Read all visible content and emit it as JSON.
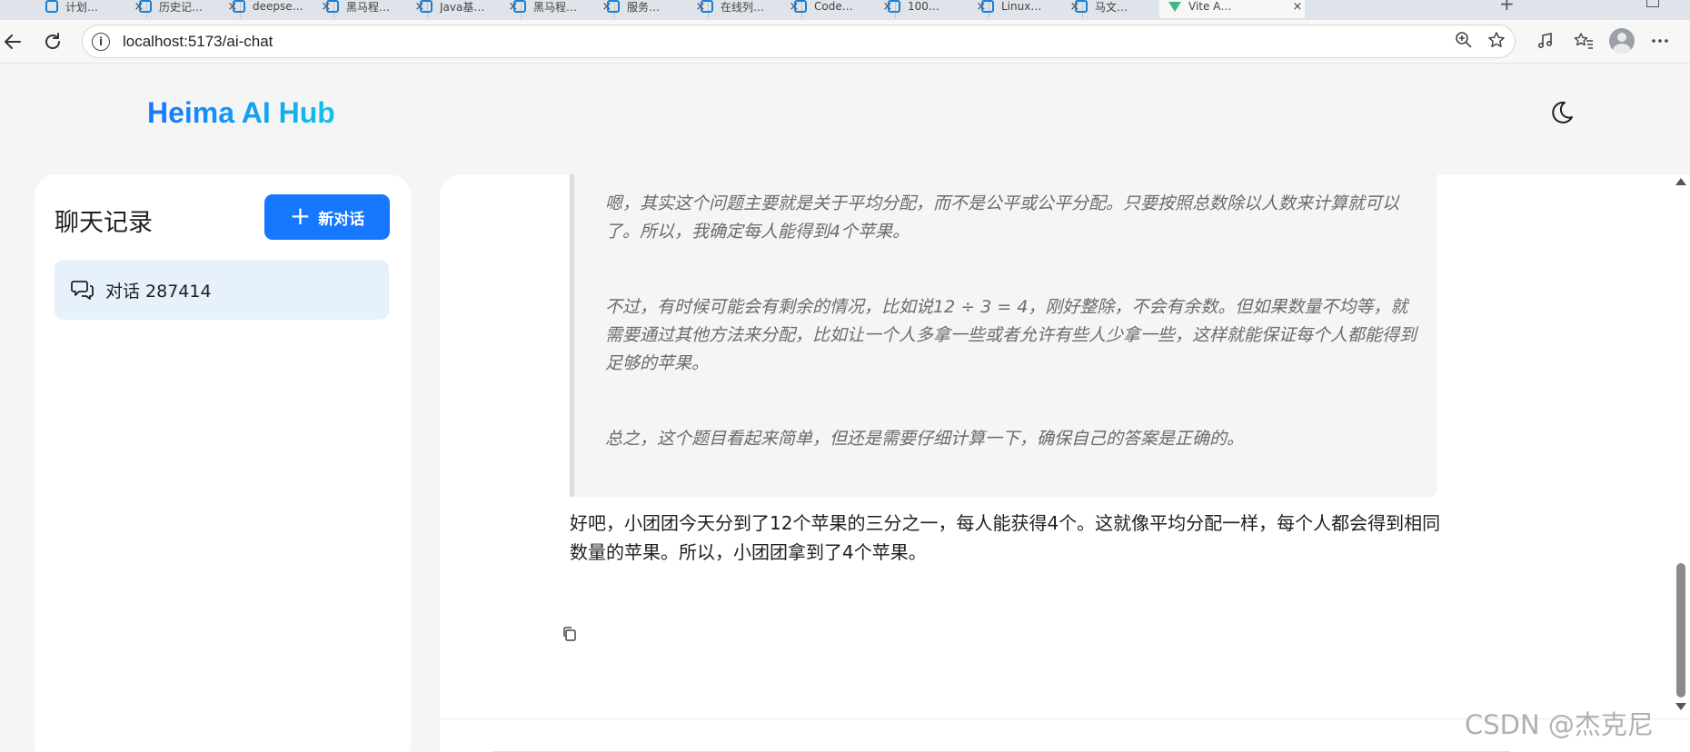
{
  "browser": {
    "tabs": [
      {
        "label": "计划…"
      },
      {
        "label": "历史记…"
      },
      {
        "label": "deepse…"
      },
      {
        "label": "黑马程…"
      },
      {
        "label": "Java基…"
      },
      {
        "label": "黑马程…"
      },
      {
        "label": "服务…"
      },
      {
        "label": "在线列…"
      },
      {
        "label": "Code…"
      },
      {
        "label": "100…"
      },
      {
        "label": "Linux…"
      },
      {
        "label": "马文…"
      },
      {
        "label": "Vite A…",
        "active": true
      }
    ],
    "url": "localhost:5173/ai-chat",
    "close_glyph": "×",
    "new_tab_glyph": "+"
  },
  "header": {
    "logo": "Heima AI Hub"
  },
  "sidebar": {
    "title": "聊天记录",
    "new_chat_label": "新对话",
    "plus_glyph": "+",
    "conversations": [
      {
        "label": "对话 287414"
      }
    ]
  },
  "chat": {
    "think_paragraphs": [
      "嗯，其实这个问题主要就是关于平均分配，而不是公平或公平分配。只要按照总数除以人数来计算就可以了。所以，我确定每人能得到4个苹果。",
      "不过，有时候可能会有剩余的情况，比如说12 ÷ 3 = 4，刚好整除，不会有余数。但如果数量不均等，就需要通过其他方法来分配，比如让一个人多拿一些或者允许有些人少拿一些，这样就能保证每个人都能得到足够的苹果。",
      "总之，这个题目看起来简单，但还是需要仔细计算一下，确保自己的答案是正确的。"
    ],
    "answer": "好吧，小团团今天分到了12个苹果的三分之一，每人能获得4个。这就像平均分配一样，每个人都会得到相同数量的苹果。所以，小团团拿到了4个苹果。"
  },
  "watermark": "CSDN @杰克尼",
  "colors": {
    "primary": "#1677ff",
    "selected_item_bg": "#e6f1fc",
    "think_text": "#6b6b6b"
  }
}
